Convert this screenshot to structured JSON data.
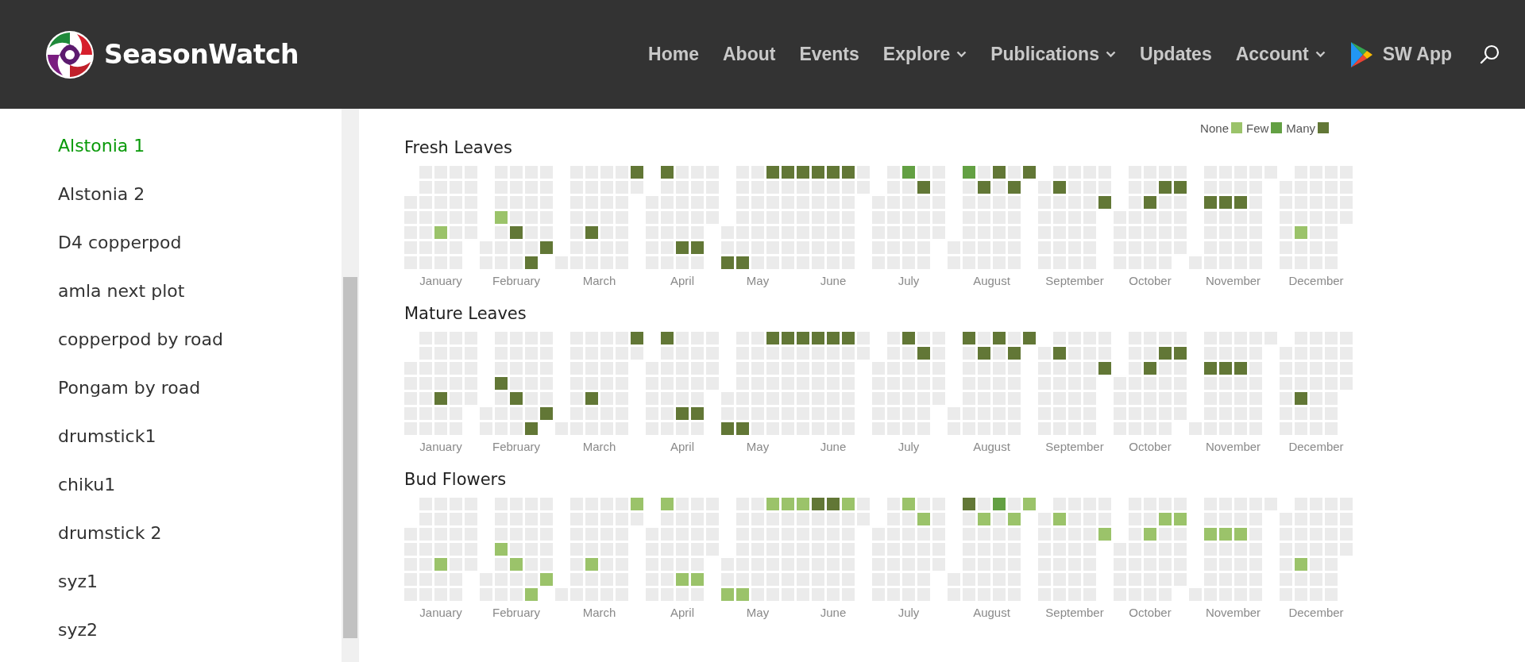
{
  "header": {
    "brand": "SeasonWatch",
    "nav": [
      {
        "label": "Home",
        "has_menu": false
      },
      {
        "label": "About",
        "has_menu": false
      },
      {
        "label": "Events",
        "has_menu": false
      },
      {
        "label": "Explore",
        "has_menu": true
      },
      {
        "label": "Publications",
        "has_menu": true
      },
      {
        "label": "Updates",
        "has_menu": false
      },
      {
        "label": "Account",
        "has_menu": true
      }
    ],
    "app_link": "SW App"
  },
  "sidebar": {
    "items": [
      {
        "label": "Alstonia 1",
        "selected": true
      },
      {
        "label": "Alstonia 2",
        "selected": false
      },
      {
        "label": "D4 copperpod",
        "selected": false
      },
      {
        "label": "amla next plot",
        "selected": false
      },
      {
        "label": "copperpod by road",
        "selected": false
      },
      {
        "label": "Pongam by road",
        "selected": false
      },
      {
        "label": "drumstick1",
        "selected": false
      },
      {
        "label": "chiku1",
        "selected": false
      },
      {
        "label": "drumstick 2",
        "selected": false
      },
      {
        "label": "syz1",
        "selected": false
      },
      {
        "label": "syz2",
        "selected": false
      }
    ]
  },
  "legend": [
    {
      "label": "None",
      "color": "#9bc36a"
    },
    {
      "label": "Few",
      "color": "#63a043"
    },
    {
      "label": "Many",
      "color": "#627736"
    }
  ],
  "sections": [
    {
      "title": "Fresh Leaves",
      "months": [
        {
          "name": "January",
          "cells": [
            {
              "kind": "blank"
            },
            {
              "kind": "blank"
            },
            {},
            {},
            {},
            {},
            {},
            {},
            {},
            {},
            {},
            {},
            {},
            {},
            {},
            {},
            {},
            {},
            {
              "kind": "none"
            },
            {},
            {},
            {},
            {},
            {},
            {},
            {},
            {},
            {},
            {},
            {},
            {},
            {},
            {}
          ]
        },
        {
          "name": "February",
          "cells": [
            {},
            {},
            {},
            {},
            {},
            {
              "kind": "none"
            },
            {},
            {},
            {},
            {},
            {},
            {},
            {},
            {
              "kind": "many"
            },
            {},
            {},
            {},
            {},
            {},
            {},
            {},
            {},
            {
              "kind": "many"
            },
            {},
            {},
            {},
            {},
            {},
            {
              "kind": "many"
            }
          ]
        },
        {
          "name": "March",
          "cells": [
            {},
            {},
            {},
            {},
            {},
            {},
            {},
            {},
            {},
            {},
            {},
            {},
            {
              "kind": "many"
            },
            {},
            {},
            {},
            {},
            {},
            {},
            {},
            {},
            {},
            {},
            {},
            {},
            {},
            {},
            {},
            {},
            {
              "kind": "many"
            },
            {}
          ]
        },
        {
          "name": "April",
          "cells": [
            {},
            {},
            {},
            {},
            {},
            {
              "kind": "many"
            },
            {},
            {},
            {},
            {},
            {},
            {},
            {},
            {},
            {},
            {},
            {},
            {
              "kind": "many"
            },
            {},
            {},
            {},
            {},
            {},
            {},
            {
              "kind": "many"
            },
            {},
            {},
            {},
            {},
            {}
          ]
        },
        {
          "name": "May",
          "cells": [
            {},
            {},
            {
              "kind": "many"
            },
            {},
            {},
            {},
            {},
            {},
            {},
            {
              "kind": "many"
            },
            {},
            {},
            {},
            {},
            {},
            {},
            {},
            {
              "kind": "many"
            },
            {},
            {},
            {},
            {},
            {},
            {},
            {
              "kind": "many"
            },
            {},
            {},
            {},
            {},
            {},
            {}
          ]
        },
        {
          "name": "June",
          "cells": [
            {
              "kind": "many"
            },
            {},
            {},
            {},
            {},
            {},
            {},
            {
              "kind": "many"
            },
            {},
            {},
            {},
            {},
            {},
            {},
            {
              "kind": "many"
            },
            {},
            {},
            {},
            {},
            {},
            {},
            {
              "kind": "many"
            },
            {},
            {},
            {},
            {},
            {},
            {},
            {},
            {}
          ]
        },
        {
          "name": "July",
          "cells": [
            {},
            {},
            {},
            {},
            {},
            {},
            {},
            {},
            {},
            {},
            {},
            {},
            {
              "kind": "few"
            },
            {},
            {},
            {},
            {},
            {},
            {},
            {},
            {
              "kind": "many"
            },
            {},
            {},
            {},
            {},
            {},
            {},
            {},
            {},
            {},
            {}
          ]
        },
        {
          "name": "August",
          "cells": [
            {},
            {},
            {
              "kind": "few"
            },
            {},
            {},
            {},
            {},
            {},
            {},
            {},
            {
              "kind": "many"
            },
            {},
            {},
            {},
            {},
            {},
            {
              "kind": "many"
            },
            {},
            {},
            {},
            {},
            {},
            {},
            {},
            {
              "kind": "many"
            },
            {},
            {},
            {},
            {},
            {},
            {
              "kind": "many"
            }
          ]
        },
        {
          "name": "September",
          "cells": [
            {},
            {},
            {},
            {},
            {},
            {},
            {},
            {
              "kind": "many"
            },
            {},
            {},
            {},
            {},
            {},
            {},
            {},
            {},
            {},
            {},
            {},
            {},
            {},
            {},
            {},
            {},
            {},
            {},
            {},
            {},
            {},
            {
              "kind": "many"
            }
          ]
        },
        {
          "name": "October",
          "cells": [
            {},
            {},
            {},
            {},
            {},
            {},
            {},
            {},
            {},
            {},
            {},
            {},
            {},
            {
              "kind": "many"
            },
            {},
            {},
            {},
            {},
            {},
            {
              "kind": "many"
            },
            {},
            {},
            {},
            {},
            {},
            {},
            {
              "kind": "many"
            },
            {},
            {},
            {},
            {}
          ]
        },
        {
          "name": "November",
          "cells": [
            {},
            {},
            {},
            {
              "kind": "many"
            },
            {},
            {},
            {},
            {},
            {},
            {},
            {
              "kind": "many"
            },
            {},
            {},
            {},
            {},
            {},
            {},
            {
              "kind": "many"
            },
            {},
            {},
            {},
            {},
            {},
            {},
            {},
            {},
            {},
            {},
            {},
            {}
          ]
        },
        {
          "name": "December",
          "cells": [
            {},
            {},
            {},
            {},
            {},
            {},
            {},
            {},
            {},
            {},
            {
              "kind": "none"
            },
            {},
            {},
            {},
            {},
            {},
            {},
            {},
            {},
            {},
            {},
            {},
            {},
            {},
            {},
            {},
            {},
            {},
            {},
            {},
            {}
          ]
        }
      ]
    },
    {
      "title": "Mature Leaves",
      "months": [
        {
          "name": "January",
          "cells": [
            {
              "kind": "blank"
            },
            {
              "kind": "blank"
            },
            {},
            {},
            {},
            {},
            {},
            {},
            {},
            {},
            {},
            {},
            {},
            {},
            {},
            {},
            {},
            {},
            {
              "kind": "many"
            },
            {},
            {},
            {},
            {},
            {},
            {},
            {},
            {},
            {},
            {},
            {},
            {},
            {},
            {}
          ]
        },
        {
          "name": "February",
          "cells": [
            {},
            {},
            {},
            {},
            {},
            {
              "kind": "many"
            },
            {},
            {},
            {},
            {},
            {},
            {},
            {},
            {
              "kind": "many"
            },
            {},
            {},
            {},
            {},
            {},
            {},
            {},
            {},
            {
              "kind": "many"
            },
            {},
            {},
            {},
            {},
            {},
            {
              "kind": "many"
            }
          ]
        },
        {
          "name": "March",
          "cells": [
            {},
            {},
            {},
            {},
            {},
            {},
            {},
            {},
            {},
            {},
            {},
            {},
            {
              "kind": "many"
            },
            {},
            {},
            {},
            {},
            {},
            {},
            {},
            {},
            {},
            {},
            {},
            {},
            {},
            {},
            {},
            {},
            {
              "kind": "many"
            },
            {}
          ]
        },
        {
          "name": "April",
          "cells": [
            {},
            {},
            {},
            {},
            {},
            {
              "kind": "many"
            },
            {},
            {},
            {},
            {},
            {},
            {},
            {},
            {},
            {},
            {},
            {},
            {
              "kind": "many"
            },
            {},
            {},
            {},
            {},
            {},
            {},
            {
              "kind": "many"
            },
            {},
            {},
            {},
            {},
            {}
          ]
        },
        {
          "name": "May",
          "cells": [
            {},
            {},
            {
              "kind": "many"
            },
            {},
            {},
            {},
            {},
            {},
            {},
            {
              "kind": "many"
            },
            {},
            {},
            {},
            {},
            {},
            {},
            {},
            {
              "kind": "many"
            },
            {},
            {},
            {},
            {},
            {},
            {},
            {
              "kind": "many"
            },
            {},
            {},
            {},
            {},
            {},
            {}
          ]
        },
        {
          "name": "June",
          "cells": [
            {
              "kind": "many"
            },
            {},
            {},
            {},
            {},
            {},
            {},
            {
              "kind": "many"
            },
            {},
            {},
            {},
            {},
            {},
            {},
            {
              "kind": "many"
            },
            {},
            {},
            {},
            {},
            {},
            {},
            {
              "kind": "many"
            },
            {},
            {},
            {},
            {},
            {},
            {},
            {},
            {}
          ]
        },
        {
          "name": "July",
          "cells": [
            {},
            {},
            {},
            {},
            {},
            {},
            {},
            {},
            {},
            {},
            {},
            {},
            {
              "kind": "many"
            },
            {},
            {},
            {},
            {},
            {},
            {},
            {},
            {
              "kind": "many"
            },
            {},
            {},
            {},
            {},
            {},
            {},
            {},
            {},
            {},
            {}
          ]
        },
        {
          "name": "August",
          "cells": [
            {},
            {},
            {
              "kind": "many"
            },
            {},
            {},
            {},
            {},
            {},
            {},
            {},
            {
              "kind": "many"
            },
            {},
            {},
            {},
            {},
            {},
            {
              "kind": "many"
            },
            {},
            {},
            {},
            {},
            {},
            {},
            {},
            {
              "kind": "many"
            },
            {},
            {},
            {},
            {},
            {},
            {
              "kind": "many"
            }
          ]
        },
        {
          "name": "September",
          "cells": [
            {},
            {},
            {},
            {},
            {},
            {},
            {},
            {
              "kind": "many"
            },
            {},
            {},
            {},
            {},
            {},
            {},
            {},
            {},
            {},
            {},
            {},
            {},
            {},
            {},
            {},
            {},
            {},
            {},
            {},
            {},
            {},
            {
              "kind": "many"
            }
          ]
        },
        {
          "name": "October",
          "cells": [
            {},
            {},
            {},
            {},
            {},
            {},
            {},
            {},
            {},
            {},
            {},
            {},
            {},
            {
              "kind": "many"
            },
            {},
            {},
            {},
            {},
            {},
            {
              "kind": "many"
            },
            {},
            {},
            {},
            {},
            {},
            {},
            {
              "kind": "many"
            },
            {},
            {},
            {},
            {}
          ]
        },
        {
          "name": "November",
          "cells": [
            {},
            {},
            {},
            {
              "kind": "many"
            },
            {},
            {},
            {},
            {},
            {},
            {},
            {
              "kind": "many"
            },
            {},
            {},
            {},
            {},
            {},
            {},
            {
              "kind": "many"
            },
            {},
            {},
            {},
            {},
            {},
            {},
            {},
            {},
            {},
            {},
            {},
            {}
          ]
        },
        {
          "name": "December",
          "cells": [
            {},
            {},
            {},
            {},
            {},
            {},
            {},
            {},
            {},
            {},
            {
              "kind": "many"
            },
            {},
            {},
            {},
            {},
            {},
            {},
            {},
            {},
            {},
            {},
            {},
            {},
            {},
            {},
            {},
            {},
            {},
            {},
            {},
            {}
          ]
        }
      ]
    },
    {
      "title": "Bud Flowers",
      "months": [
        {
          "name": "January",
          "cells": [
            {
              "kind": "blank"
            },
            {
              "kind": "blank"
            },
            {},
            {},
            {},
            {},
            {},
            {},
            {},
            {},
            {},
            {},
            {},
            {},
            {},
            {},
            {},
            {},
            {
              "kind": "none"
            },
            {},
            {},
            {},
            {},
            {},
            {},
            {},
            {},
            {},
            {},
            {},
            {},
            {},
            {}
          ]
        },
        {
          "name": "February",
          "cells": [
            {},
            {},
            {},
            {},
            {},
            {
              "kind": "none"
            },
            {},
            {},
            {},
            {},
            {},
            {},
            {},
            {
              "kind": "none"
            },
            {},
            {},
            {},
            {},
            {},
            {},
            {},
            {},
            {
              "kind": "none"
            },
            {},
            {},
            {},
            {},
            {},
            {
              "kind": "none"
            }
          ]
        },
        {
          "name": "March",
          "cells": [
            {},
            {},
            {},
            {},
            {},
            {},
            {},
            {},
            {},
            {},
            {},
            {},
            {
              "kind": "none"
            },
            {},
            {},
            {},
            {},
            {},
            {},
            {},
            {},
            {},
            {},
            {},
            {},
            {},
            {},
            {},
            {},
            {
              "kind": "none"
            },
            {}
          ]
        },
        {
          "name": "April",
          "cells": [
            {},
            {},
            {},
            {},
            {},
            {
              "kind": "none"
            },
            {},
            {},
            {},
            {},
            {},
            {},
            {},
            {},
            {},
            {},
            {},
            {
              "kind": "none"
            },
            {},
            {},
            {},
            {},
            {},
            {},
            {
              "kind": "none"
            },
            {},
            {},
            {},
            {},
            {}
          ]
        },
        {
          "name": "May",
          "cells": [
            {},
            {},
            {
              "kind": "none"
            },
            {},
            {},
            {},
            {},
            {},
            {},
            {
              "kind": "none"
            },
            {},
            {},
            {},
            {},
            {},
            {},
            {},
            {
              "kind": "none"
            },
            {},
            {},
            {},
            {},
            {},
            {},
            {
              "kind": "none"
            },
            {},
            {},
            {},
            {},
            {},
            {}
          ]
        },
        {
          "name": "June",
          "cells": [
            {
              "kind": "none"
            },
            {},
            {},
            {},
            {},
            {},
            {},
            {
              "kind": "many"
            },
            {},
            {},
            {},
            {},
            {},
            {},
            {
              "kind": "many"
            },
            {},
            {},
            {},
            {},
            {},
            {},
            {
              "kind": "none"
            },
            {},
            {},
            {},
            {},
            {},
            {},
            {},
            {}
          ]
        },
        {
          "name": "July",
          "cells": [
            {},
            {},
            {},
            {},
            {},
            {},
            {},
            {},
            {},
            {},
            {},
            {},
            {
              "kind": "none"
            },
            {},
            {},
            {},
            {},
            {},
            {},
            {},
            {
              "kind": "none"
            },
            {},
            {},
            {},
            {},
            {},
            {},
            {},
            {},
            {},
            {}
          ]
        },
        {
          "name": "August",
          "cells": [
            {},
            {},
            {
              "kind": "many"
            },
            {},
            {},
            {},
            {},
            {},
            {},
            {},
            {
              "kind": "none"
            },
            {},
            {},
            {},
            {},
            {},
            {
              "kind": "few"
            },
            {},
            {},
            {},
            {},
            {},
            {},
            {},
            {
              "kind": "none"
            },
            {},
            {},
            {},
            {},
            {},
            {
              "kind": "none"
            }
          ]
        },
        {
          "name": "September",
          "cells": [
            {},
            {},
            {},
            {},
            {},
            {},
            {},
            {
              "kind": "none"
            },
            {},
            {},
            {},
            {},
            {},
            {},
            {},
            {},
            {},
            {},
            {},
            {},
            {},
            {},
            {},
            {},
            {},
            {},
            {},
            {},
            {},
            {
              "kind": "none"
            }
          ]
        },
        {
          "name": "October",
          "cells": [
            {},
            {},
            {},
            {},
            {},
            {},
            {},
            {},
            {},
            {},
            {},
            {},
            {},
            {
              "kind": "none"
            },
            {},
            {},
            {},
            {},
            {},
            {
              "kind": "none"
            },
            {},
            {},
            {},
            {},
            {},
            {},
            {
              "kind": "none"
            },
            {},
            {},
            {},
            {}
          ]
        },
        {
          "name": "November",
          "cells": [
            {},
            {},
            {},
            {
              "kind": "none"
            },
            {},
            {},
            {},
            {},
            {},
            {},
            {
              "kind": "none"
            },
            {},
            {},
            {},
            {},
            {},
            {},
            {
              "kind": "none"
            },
            {},
            {},
            {},
            {},
            {},
            {},
            {},
            {},
            {},
            {},
            {},
            {}
          ]
        },
        {
          "name": "December",
          "cells": [
            {},
            {},
            {},
            {},
            {},
            {},
            {},
            {},
            {},
            {},
            {
              "kind": "none"
            },
            {},
            {},
            {},
            {},
            {},
            {},
            {},
            {},
            {},
            {},
            {},
            {},
            {},
            {},
            {},
            {},
            {},
            {},
            {},
            {}
          ]
        }
      ]
    }
  ]
}
